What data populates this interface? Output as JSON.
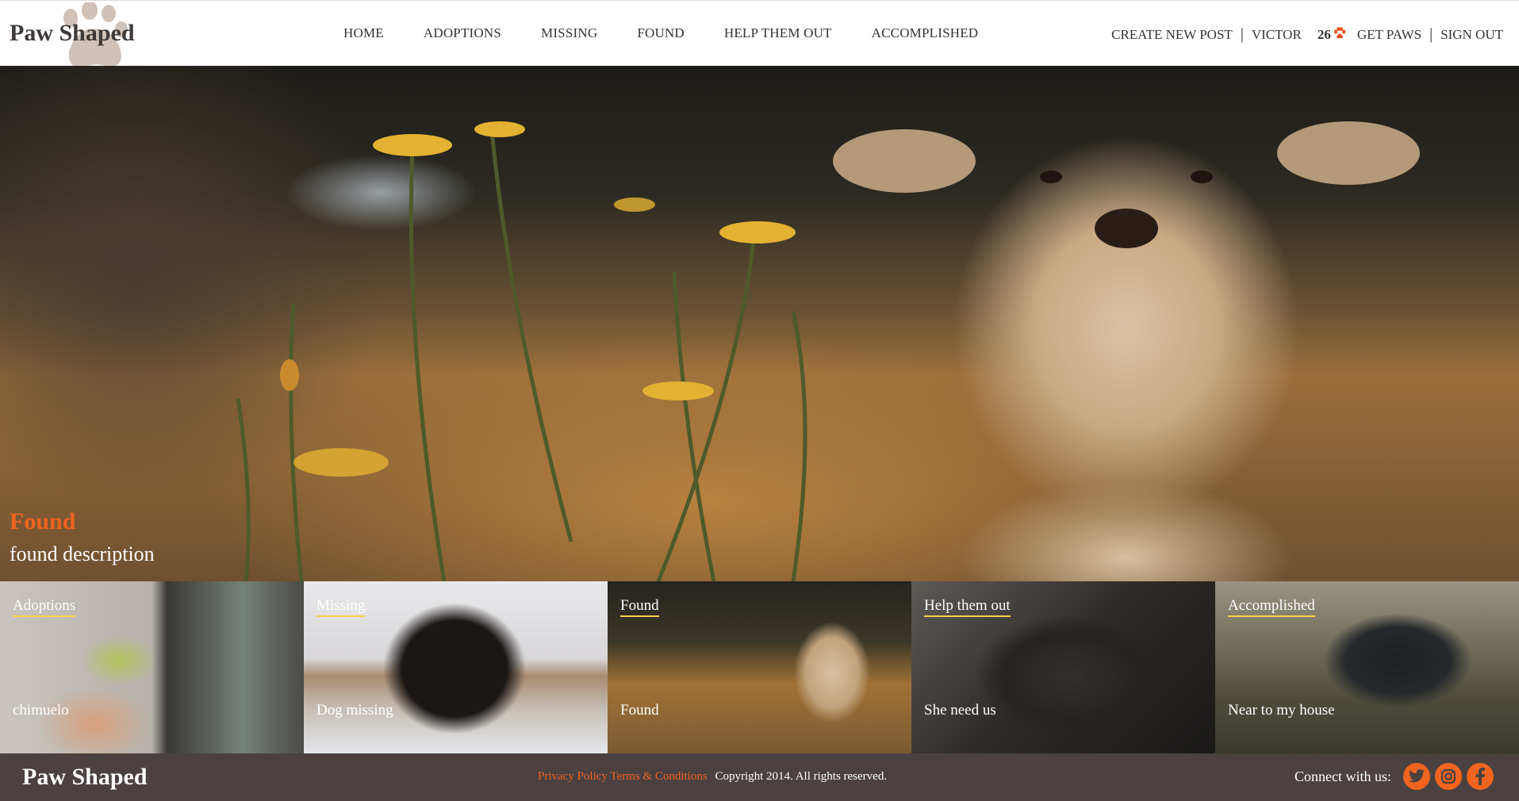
{
  "header": {
    "logo_text": "Paw Shaped",
    "nav": [
      "HOME",
      "ADOPTIONS",
      "MISSING",
      "FOUND",
      "HELP THEM OUT",
      "ACCOMPLISHED"
    ],
    "create_post": "CREATE NEW POST",
    "username": "VICTOR",
    "paw_count": "26",
    "get_paws": "GET PAWS",
    "sign_out": "SIGN OUT",
    "separator": "|"
  },
  "hero": {
    "title": "Found",
    "description": "found description"
  },
  "tiles": [
    {
      "label": "Adoptions",
      "caption": "chimuelo"
    },
    {
      "label": "Missing",
      "caption": "Dog missing"
    },
    {
      "label": "Found",
      "caption": "Found"
    },
    {
      "label": "Help them out",
      "caption": "She need us"
    },
    {
      "label": "Accomplished",
      "caption": "Near to my house"
    }
  ],
  "footer": {
    "logo_text": "Paw Shaped",
    "privacy": "Privacy Policy",
    "terms": "Terms & Conditions",
    "copyright": "Copyright 2014. All rights reserved.",
    "connect_label": "Connect with us:",
    "social": [
      "twitter-icon",
      "instagram-icon",
      "facebook-icon"
    ]
  },
  "colors": {
    "accent": "#f0641e",
    "footer_bg": "#4a4140",
    "tile_underline": "#f5d24a"
  }
}
